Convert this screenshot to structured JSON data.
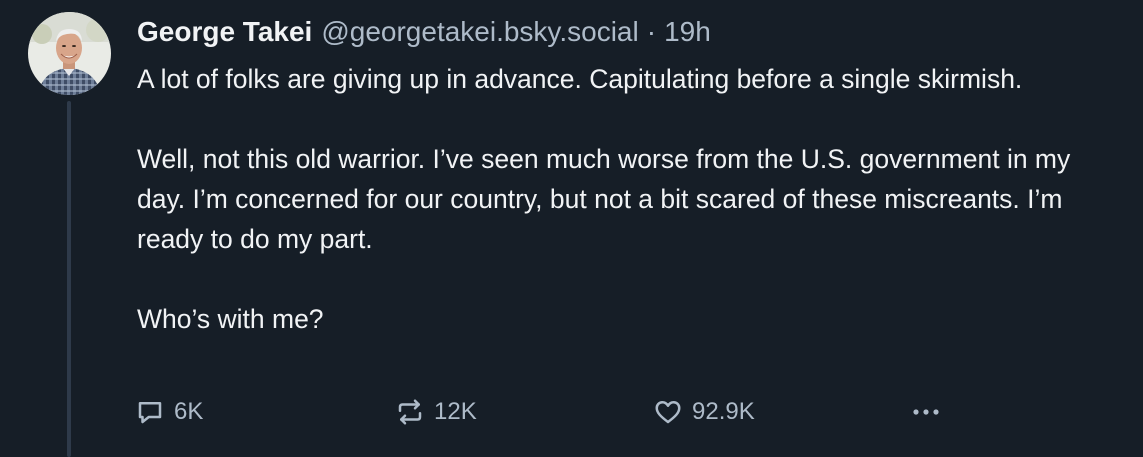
{
  "post": {
    "author": {
      "display_name": "George Takei",
      "handle": "@georgetakei.bsky.social",
      "separator": "·",
      "timestamp": "19h",
      "avatar_icon": "user-avatar"
    },
    "text": {
      "line1": "A lot of folks are giving up in advance. Capitulating before a single skirmish.",
      "line2": "Well, not this old warrior. I’ve seen much worse from the U.S. government in my day. I’m concerned for our country, but not a bit scared of these miscreants. I’m ready to do my part.",
      "line3": "Who’s with me?"
    },
    "actions": {
      "reply": {
        "icon": "reply-icon",
        "count": "6K"
      },
      "repost": {
        "icon": "repost-icon",
        "count": "12K"
      },
      "like": {
        "icon": "heart-icon",
        "count": "92.9K"
      },
      "more": {
        "icon": "more-options-icon"
      }
    },
    "colors": {
      "background": "#161e27",
      "text_primary": "#f1f3f5",
      "text_secondary": "#aebbc9",
      "thread_line": "#2e3a4a"
    }
  }
}
